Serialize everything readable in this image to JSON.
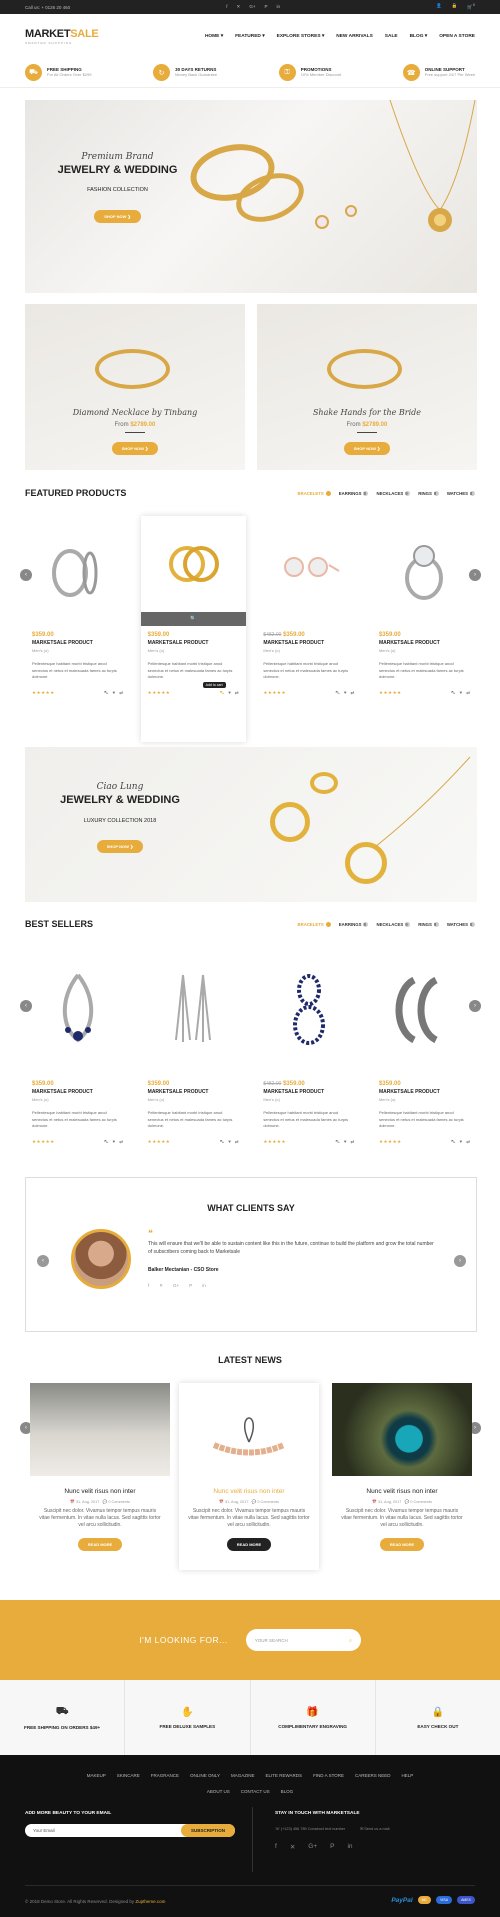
{
  "topbar": {
    "call": "Call us: + 0126 20 460",
    "social": [
      "f",
      "✕",
      "G+",
      "P",
      "in"
    ],
    "icons": [
      "person-icon",
      "lock-icon",
      "cart-icon"
    ],
    "cart_count": "0"
  },
  "header": {
    "logo_main": "MARKET",
    "logo_accent": "SALE",
    "tagline": "SMARTER SHOPPING",
    "nav": [
      "HOME ▾",
      "FEATURED ▾",
      "EXPLORE STORES ▾",
      "NEW ARRIVALS",
      "SALE",
      "BLOG ▾",
      "OPEN A STORE"
    ]
  },
  "features": [
    {
      "title": "FREE SHIPPING",
      "sub": "For All Orders Over $299",
      "icon": "truck-icon",
      "glyph": "⛟"
    },
    {
      "title": "30 DAYS RETURNS",
      "sub": "Money Back Guarantee",
      "icon": "refresh-icon",
      "glyph": "↻"
    },
    {
      "title": "PROMOTIONS",
      "sub": "10% Member Discount",
      "icon": "bag-icon",
      "glyph": "⚿"
    },
    {
      "title": "ONLINE SUPPORT",
      "sub": "Free support 24/7 Per Week",
      "icon": "headset-icon",
      "glyph": "☎"
    }
  ],
  "hero": {
    "script": "Premium Brand",
    "title": "JEWELRY & WEDDING",
    "subtitle": "FASHION COLLECTION",
    "button": "SHOP NOW"
  },
  "promos": [
    {
      "title": "Diamond Necklace by Tinbang",
      "from": "From",
      "price": "$2789.00",
      "button": "SHOP NOW"
    },
    {
      "title": "Shake Hands for the Bride",
      "from": "From",
      "price": "$2789.00",
      "button": "SHOP NOW"
    }
  ],
  "featured": {
    "title": "FEATURED PRODUCTS",
    "tabs": [
      {
        "label": "BRACELETS",
        "n": "6"
      },
      {
        "label": "EARRINGS",
        "n": "9"
      },
      {
        "label": "NECKLACES",
        "n": "9"
      },
      {
        "label": "RINGS",
        "n": "9"
      },
      {
        "label": "WATCHES",
        "n": "8"
      }
    ],
    "tooltip": "Add to cart"
  },
  "product_common": {
    "name": "MARKETSALE PRODUCT",
    "cat": "Men's (o)",
    "desc": "Pellentesque habitant morbi tristique anod senectus et netus et malesuada fames ac turpis dolmone.",
    "stars": "★★★★★"
  },
  "featured_products": [
    {
      "price": "$359.00",
      "old": "",
      "img": "hoops"
    },
    {
      "price": "$359.00",
      "old": "",
      "img": "gold-rings"
    },
    {
      "price": "$359.00",
      "old": "$482.00",
      "img": "studs"
    },
    {
      "price": "$359.00",
      "old": "",
      "img": "diamond-ring"
    }
  ],
  "banner2": {
    "script": "Ciao Lung",
    "title": "JEWELRY & WEDDING",
    "subtitle": "LUXURY COLLECTION 2018",
    "button": "SHOP NOW"
  },
  "bestsellers": {
    "title": "BEST SELLERS",
    "tabs": [
      {
        "label": "BRACELETS",
        "n": "6"
      },
      {
        "label": "EARRINGS",
        "n": "9"
      },
      {
        "label": "NECKLACES",
        "n": "9"
      },
      {
        "label": "RINGS",
        "n": "9"
      },
      {
        "label": "WATCHES",
        "n": "8"
      }
    ]
  },
  "best_products": [
    {
      "price": "$359.00",
      "old": ""
    },
    {
      "price": "$359.00",
      "old": ""
    },
    {
      "price": "$359.00",
      "old": "$482.00"
    },
    {
      "price": "$359.00",
      "old": ""
    }
  ],
  "testimonial": {
    "title": "WHAT CLIENTS SAY",
    "quote": "This will ensure that we'll be able to sustain content like this in the future, continue to build the platform and grow the total number of subscribers coming back to Marketsale",
    "author": "Balker Mectanian - CSO Store",
    "social": [
      "f",
      "✕",
      "G+",
      "P",
      "in"
    ]
  },
  "news": {
    "title": "LATEST NEWS",
    "items": [
      {
        "title": "Nunc velit risus non inter",
        "date": "31, Aug, 2017",
        "comments": "0 Comments",
        "text": "Suscipit nec dolor. Vivamus tempor tempus mauris vitae fermentum. In vitae nulla lacus. Sed sagittis tortor vel arcu sollicitudin.",
        "button": "READ MORE"
      },
      {
        "title": "Nunc velit risus non inter",
        "date": "31, Aug, 2017",
        "comments": "0 Comments",
        "text": "Suscipit nec dolor. Vivamus tempor tempus mauris vitae fermentum. In vitae nulla lacus. Sed sagittis tortor vel arcu sollicitudin.",
        "button": "READ MORE"
      },
      {
        "title": "Nunc velit risus non inter",
        "date": "31, Aug, 2017",
        "comments": "0 Comments",
        "text": "Suscipit nec dolor. Vivamus tempor tempus mauris vitae fermentum. In vitae nulla lacus. Sed sagittis tortor vel arcu sollicitudin.",
        "button": "READ MORE"
      }
    ]
  },
  "search": {
    "label": "I'M LOOKING FOR...",
    "placeholder": "YOUR SEARCH"
  },
  "services": [
    {
      "label": "FREE SHIPPING ON ORDERS $49+",
      "glyph": "⛟"
    },
    {
      "label": "FREE DELUXE SAMPLES",
      "glyph": "✋"
    },
    {
      "label": "COMPLIMENTARY ENGRAVING",
      "glyph": "🎁"
    },
    {
      "label": "EASY CHECK OUT",
      "glyph": "🔒"
    }
  ],
  "footer": {
    "links1": [
      "MAKEUP",
      "SKINCARE",
      "FRAGRANCE",
      "ONLINE ONLY",
      "MAGAZINE",
      "ELITE REWARDS",
      "FIND A STORE",
      "CAREERS NEED",
      "HELP"
    ],
    "links2": [
      "ABOUT US",
      "CONTACT US",
      "BLOG"
    ],
    "newsletter_title": "ADD MORE BEAUTY TO YOUR EMAIL",
    "email_placeholder": "Your Email",
    "subscribe": "SUBSCRIPTION",
    "touch_title": "STAY IN TOUCH WITH MARKETSALE",
    "phone": "(+123) 456 789 Construct text number",
    "mail": "Send us a mail",
    "social": [
      "f",
      "✕",
      "G+",
      "P",
      "in"
    ],
    "copyright": "© 2018 Demo Store. All Rights Reserved. Designed by ",
    "designer": "Zuptheme.com",
    "payments": [
      "PayPal",
      "MC",
      "VISA",
      "AMEX"
    ]
  },
  "colors": {
    "accent": "#e7ac3b",
    "dark": "#111111"
  }
}
